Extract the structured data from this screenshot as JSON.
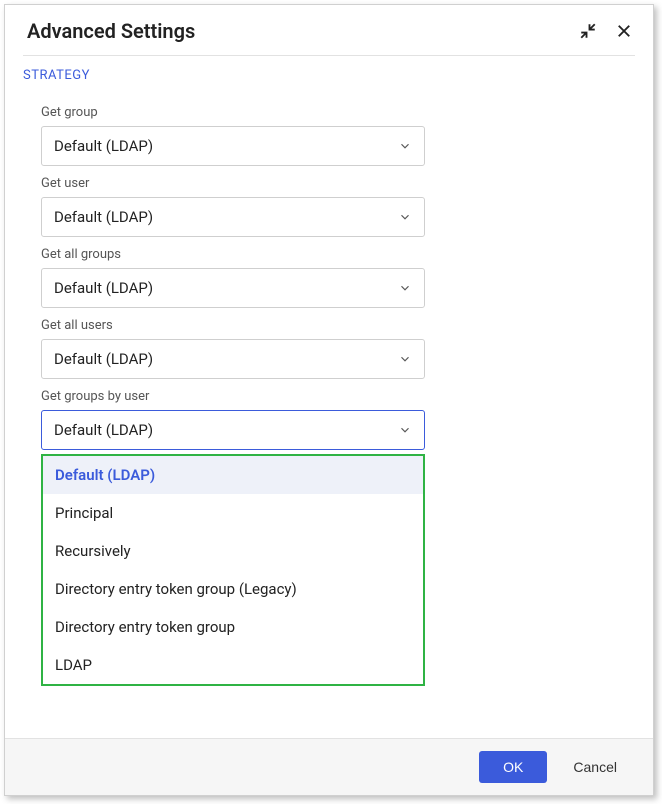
{
  "dialog": {
    "title": "Advanced Settings"
  },
  "section": {
    "title": "STRATEGY"
  },
  "fields": {
    "get_group": {
      "label": "Get group",
      "value": "Default (LDAP)"
    },
    "get_user": {
      "label": "Get user",
      "value": "Default (LDAP)"
    },
    "get_all_groups": {
      "label": "Get all groups",
      "value": "Default (LDAP)"
    },
    "get_all_users": {
      "label": "Get all users",
      "value": "Default (LDAP)"
    },
    "get_groups_by_user": {
      "label": "Get groups by user",
      "value": "Default (LDAP)"
    }
  },
  "dropdown_options": [
    "Default (LDAP)",
    "Principal",
    "Recursively",
    "Directory entry token group (Legacy)",
    "Directory entry token group",
    "LDAP"
  ],
  "footer": {
    "ok": "OK",
    "cancel": "Cancel"
  }
}
